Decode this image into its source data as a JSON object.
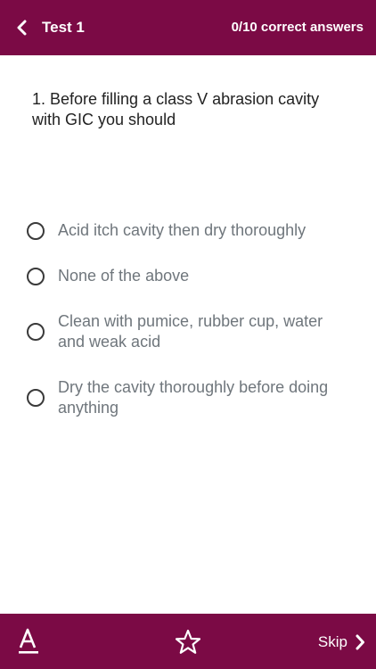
{
  "header": {
    "title": "Test 1",
    "score": "0/10 correct answers",
    "background_color": "#7b0a45"
  },
  "question": {
    "text": "1. Before filling a class V abrasion cavity with GIC you should"
  },
  "options": [
    {
      "label": "Acid itch cavity then dry thoroughly",
      "selected": false
    },
    {
      "label": "None of the above",
      "selected": false
    },
    {
      "label": "Clean with pumice, rubber cup, water and weak acid",
      "selected": false
    },
    {
      "label": "Dry the cavity thoroughly before doing anything",
      "selected": false
    }
  ],
  "footer": {
    "font_icon": "font-size-icon",
    "favorite_icon": "star-outline-icon",
    "skip_label": "Skip",
    "skip_icon": "chevron-right-icon"
  }
}
